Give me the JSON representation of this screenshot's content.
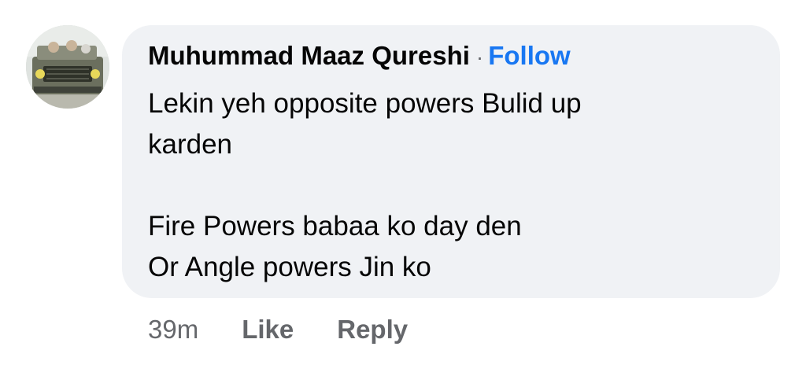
{
  "comment": {
    "author": "Muhummad Maaz Qureshi",
    "separator": "·",
    "follow_label": "Follow",
    "lines": [
      "Lekin yeh opposite powers Bulid up",
      "karden",
      "",
      "Fire Powers babaa ko day den",
      "Or Angle powers Jin ko"
    ]
  },
  "actions": {
    "timestamp": "39m",
    "like_label": "Like",
    "reply_label": "Reply"
  },
  "colors": {
    "bubble_background": "#f0f2f5",
    "link_blue": "#1877f2",
    "secondary_text": "#65676b",
    "primary_text": "#050505"
  }
}
